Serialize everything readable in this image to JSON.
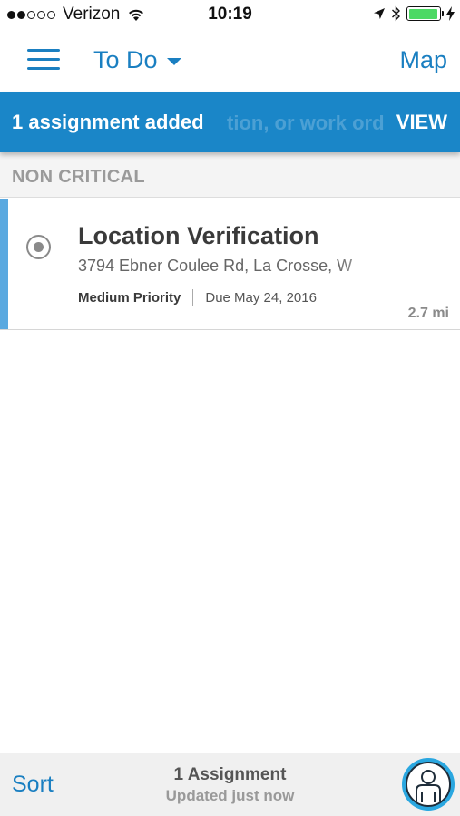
{
  "status_bar": {
    "carrier": "Verizon",
    "time": "10:19",
    "signal_bars_filled": 2,
    "signal_bars_total": 5,
    "battery_level": 0.95,
    "battery_color": "#4cd964"
  },
  "nav": {
    "title": "To Do",
    "map_label": "Map"
  },
  "banner": {
    "message": "1 assignment added",
    "ghost_text": "tion, or work ord",
    "view_label": "VIEW",
    "color": "#1a86c8"
  },
  "section": {
    "header": "NON CRITICAL"
  },
  "assignments": [
    {
      "title": "Location Verification",
      "address": "3794 Ebner Coulee Rd, La Crosse, W",
      "priority": "Medium Priority",
      "due": "Due May 24, 2016",
      "distance": "2.7 mi"
    }
  ],
  "bottom_bar": {
    "sort_label": "Sort",
    "count": "1 Assignment",
    "updated": "Updated just now"
  },
  "colors": {
    "accent": "#1a7fc1",
    "row_accent": "#5aa9e0",
    "profile_ring": "#2aa7e0"
  },
  "icons": {
    "menu": "hamburger-menu-icon",
    "title_dropdown": "caret-down-icon",
    "status": "radio-circle-icon",
    "profile": "person-icon",
    "wifi": "wifi-icon",
    "location": "location-arrow-icon",
    "bluetooth": "bluetooth-icon",
    "charging": "charging-bolt-icon"
  }
}
